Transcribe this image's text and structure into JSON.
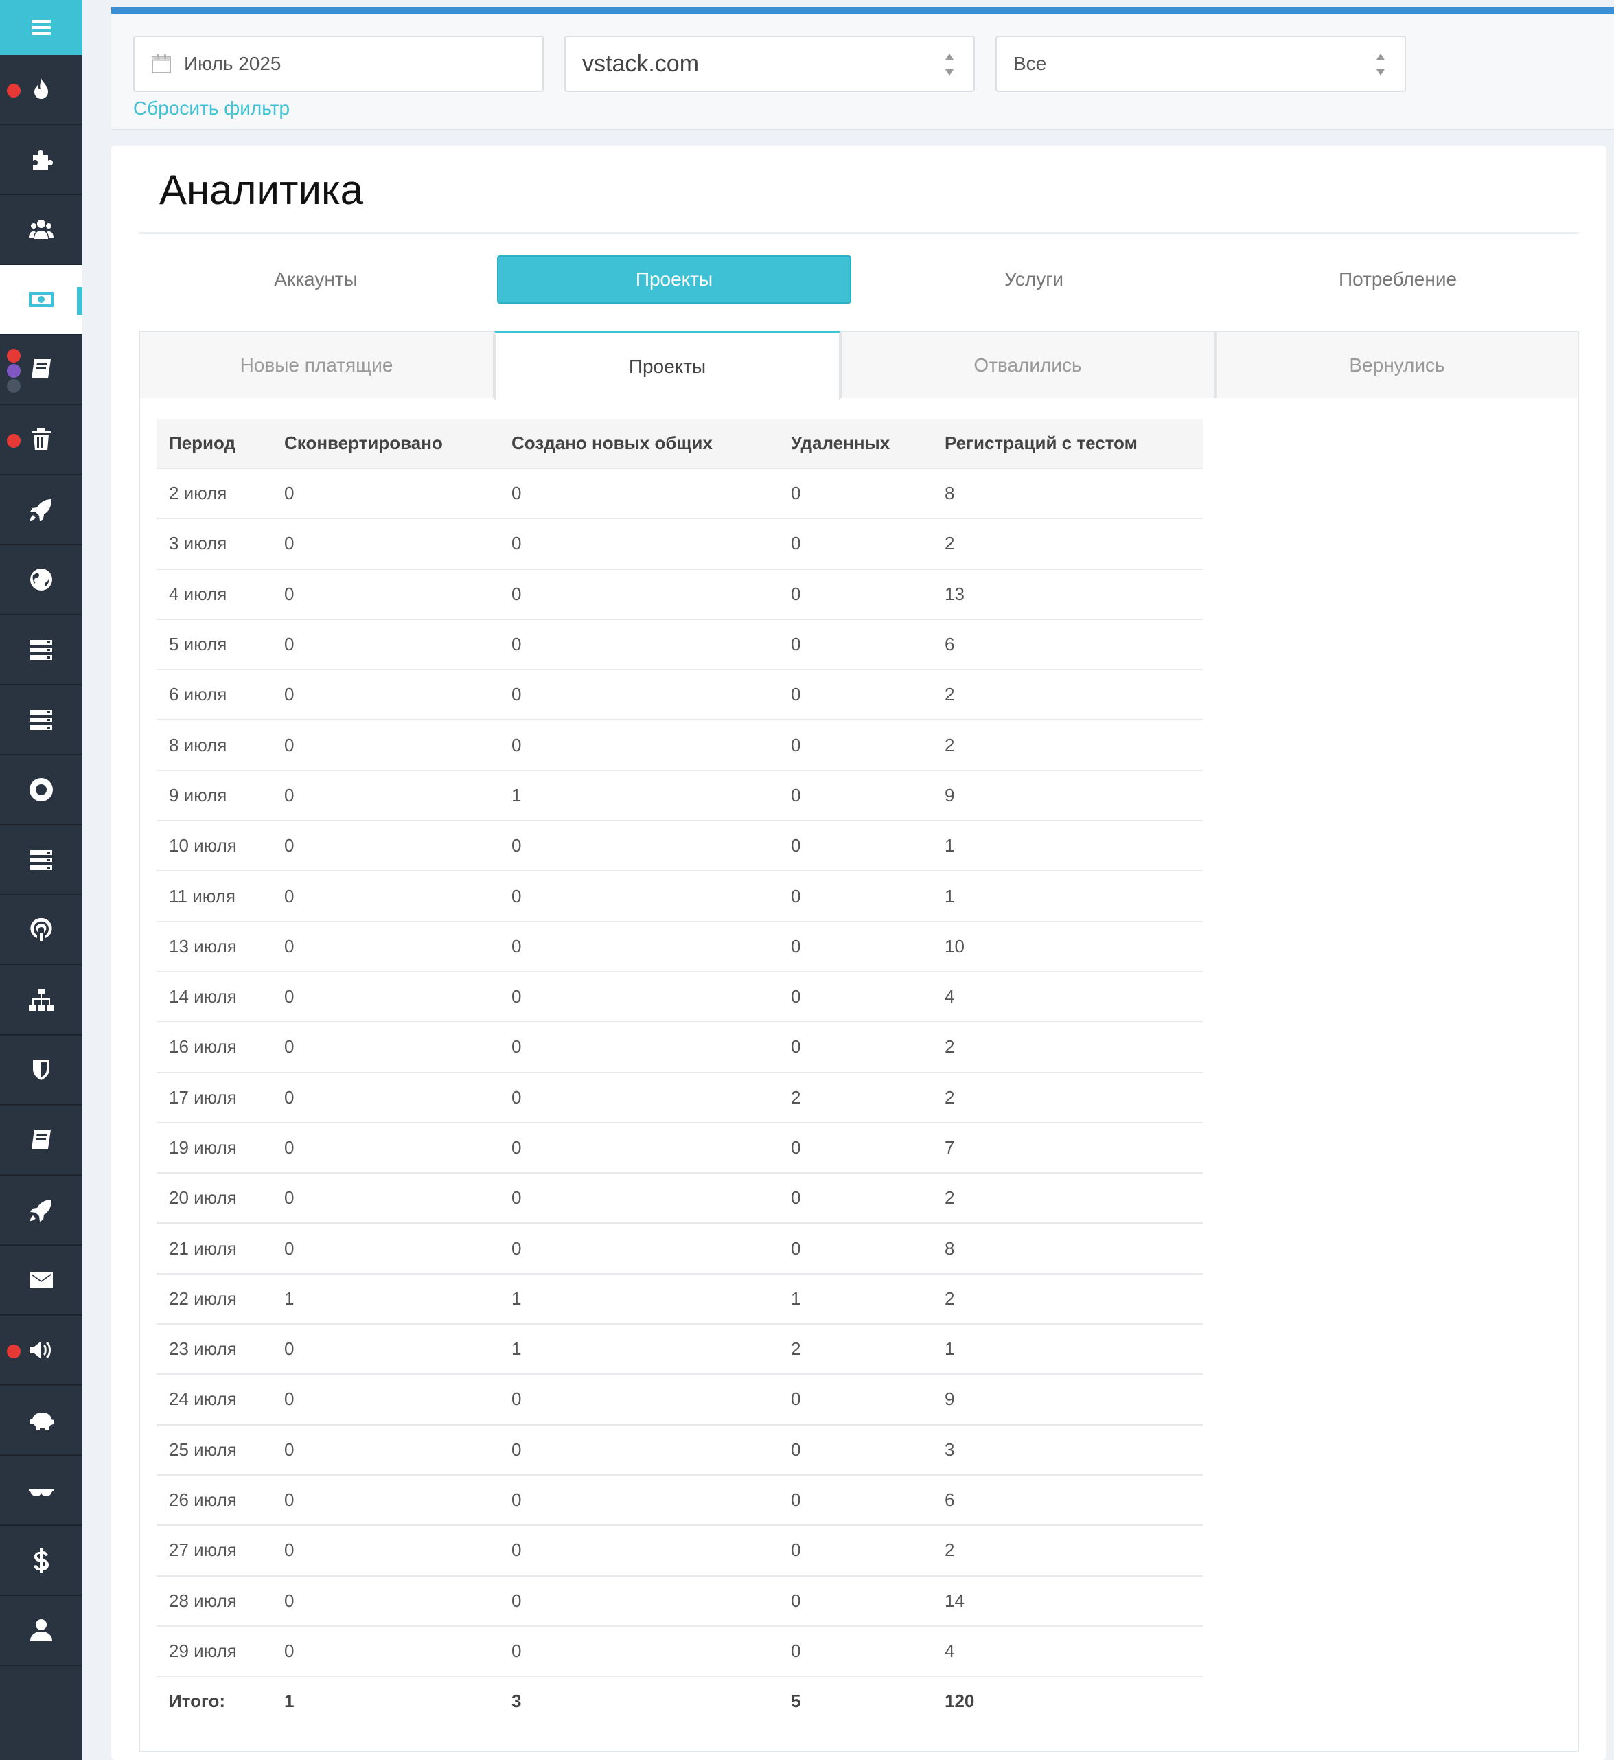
{
  "sidebar": {
    "menu_icon": "hamburger-icon",
    "items": [
      {
        "icon": "fire-icon",
        "dots": [
          "red"
        ]
      },
      {
        "icon": "puzzle-icon",
        "dots": []
      },
      {
        "icon": "users-icon",
        "dots": []
      },
      {
        "icon": "money-icon",
        "dots": [],
        "active": true
      },
      {
        "icon": "book-icon",
        "dots": [
          "red",
          "purple",
          "grey"
        ]
      },
      {
        "icon": "trash-icon",
        "dots": [
          "red"
        ]
      },
      {
        "icon": "rocket-icon",
        "dots": []
      },
      {
        "icon": "globe-icon",
        "dots": []
      },
      {
        "icon": "server-icon",
        "dots": []
      },
      {
        "icon": "server-icon",
        "dots": []
      },
      {
        "icon": "lifebuoy-icon",
        "dots": []
      },
      {
        "icon": "server-icon",
        "dots": []
      },
      {
        "icon": "podcast-icon",
        "dots": []
      },
      {
        "icon": "sitemap-icon",
        "dots": []
      },
      {
        "icon": "shield-icon",
        "dots": []
      },
      {
        "icon": "book-icon",
        "dots": []
      },
      {
        "icon": "rocket-icon",
        "dots": []
      },
      {
        "icon": "envelope-icon",
        "dots": []
      },
      {
        "icon": "megaphone-icon",
        "dots": [
          "red"
        ]
      },
      {
        "icon": "piggy-bank-icon",
        "dots": []
      },
      {
        "icon": "glasses-icon",
        "dots": []
      },
      {
        "icon": "dollar-icon",
        "dots": []
      },
      {
        "icon": "user-icon",
        "dots": []
      }
    ],
    "colors": {
      "background": "#2a3340",
      "accent": "#3fc1d5",
      "dot_red": "#e53935",
      "dot_purple": "#7e57c2",
      "dot_grey": "#4a5563"
    }
  },
  "filters": {
    "month": "Июль 2025",
    "domain": "vstack.com",
    "scope": "Все",
    "reset_label": "Сбросить фильтр",
    "accent_bar_color": "#3b8fd4"
  },
  "page": {
    "title": "Аналитика"
  },
  "main_tabs": [
    {
      "label": "Аккаунты",
      "active": false
    },
    {
      "label": "Проекты",
      "active": true
    },
    {
      "label": "Услуги",
      "active": false
    },
    {
      "label": "Потребление",
      "active": false
    }
  ],
  "sub_tabs": [
    {
      "label": "Новые платящие",
      "active": false
    },
    {
      "label": "Проекты",
      "active": true
    },
    {
      "label": "Отвалились",
      "active": false
    },
    {
      "label": "Вернулись",
      "active": false
    }
  ],
  "table": {
    "columns": [
      "Период",
      "Сконвертировано",
      "Создано новых общих",
      "Удаленных",
      "Регистраций с тестом"
    ],
    "rows": [
      [
        "2 июля",
        "0",
        "0",
        "0",
        "8"
      ],
      [
        "3 июля",
        "0",
        "0",
        "0",
        "2"
      ],
      [
        "4 июля",
        "0",
        "0",
        "0",
        "13"
      ],
      [
        "5 июля",
        "0",
        "0",
        "0",
        "6"
      ],
      [
        "6 июля",
        "0",
        "0",
        "0",
        "2"
      ],
      [
        "8 июля",
        "0",
        "0",
        "0",
        "2"
      ],
      [
        "9 июля",
        "0",
        "1",
        "0",
        "9"
      ],
      [
        "10 июля",
        "0",
        "0",
        "0",
        "1"
      ],
      [
        "11 июля",
        "0",
        "0",
        "0",
        "1"
      ],
      [
        "13 июля",
        "0",
        "0",
        "0",
        "10"
      ],
      [
        "14 июля",
        "0",
        "0",
        "0",
        "4"
      ],
      [
        "16 июля",
        "0",
        "0",
        "0",
        "2"
      ],
      [
        "17 июля",
        "0",
        "0",
        "2",
        "2"
      ],
      [
        "19 июля",
        "0",
        "0",
        "0",
        "7"
      ],
      [
        "20 июля",
        "0",
        "0",
        "0",
        "2"
      ],
      [
        "21 июля",
        "0",
        "0",
        "0",
        "8"
      ],
      [
        "22 июля",
        "1",
        "1",
        "1",
        "2"
      ],
      [
        "23 июля",
        "0",
        "1",
        "2",
        "1"
      ],
      [
        "24 июля",
        "0",
        "0",
        "0",
        "9"
      ],
      [
        "25 июля",
        "0",
        "0",
        "0",
        "3"
      ],
      [
        "26 июля",
        "0",
        "0",
        "0",
        "6"
      ],
      [
        "27 июля",
        "0",
        "0",
        "0",
        "2"
      ],
      [
        "28 июля",
        "0",
        "0",
        "0",
        "14"
      ],
      [
        "29 июля",
        "0",
        "0",
        "0",
        "4"
      ]
    ],
    "total": [
      "Итого:",
      "1",
      "3",
      "5",
      "120"
    ]
  }
}
